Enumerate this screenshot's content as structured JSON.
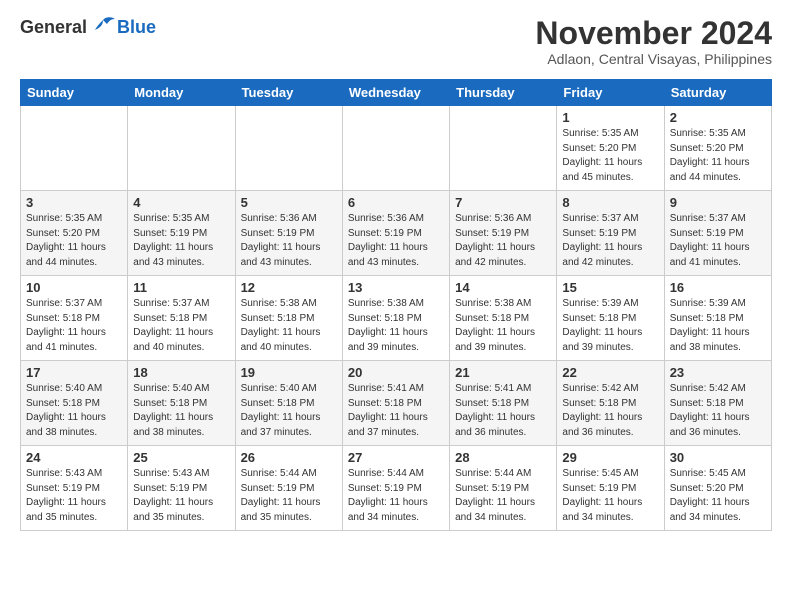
{
  "header": {
    "logo": {
      "general": "General",
      "blue": "Blue"
    },
    "month": "November 2024",
    "location": "Adlaon, Central Visayas, Philippines"
  },
  "weekdays": [
    "Sunday",
    "Monday",
    "Tuesday",
    "Wednesday",
    "Thursday",
    "Friday",
    "Saturday"
  ],
  "weeks": [
    [
      {
        "day": null
      },
      {
        "day": null
      },
      {
        "day": null
      },
      {
        "day": null
      },
      {
        "day": null
      },
      {
        "day": 1,
        "sunrise": "5:35 AM",
        "sunset": "5:20 PM",
        "daylight": "11 hours and 45 minutes."
      },
      {
        "day": 2,
        "sunrise": "5:35 AM",
        "sunset": "5:20 PM",
        "daylight": "11 hours and 44 minutes."
      }
    ],
    [
      {
        "day": 3,
        "sunrise": "5:35 AM",
        "sunset": "5:20 PM",
        "daylight": "11 hours and 44 minutes."
      },
      {
        "day": 4,
        "sunrise": "5:35 AM",
        "sunset": "5:19 PM",
        "daylight": "11 hours and 43 minutes."
      },
      {
        "day": 5,
        "sunrise": "5:36 AM",
        "sunset": "5:19 PM",
        "daylight": "11 hours and 43 minutes."
      },
      {
        "day": 6,
        "sunrise": "5:36 AM",
        "sunset": "5:19 PM",
        "daylight": "11 hours and 43 minutes."
      },
      {
        "day": 7,
        "sunrise": "5:36 AM",
        "sunset": "5:19 PM",
        "daylight": "11 hours and 42 minutes."
      },
      {
        "day": 8,
        "sunrise": "5:37 AM",
        "sunset": "5:19 PM",
        "daylight": "11 hours and 42 minutes."
      },
      {
        "day": 9,
        "sunrise": "5:37 AM",
        "sunset": "5:19 PM",
        "daylight": "11 hours and 41 minutes."
      }
    ],
    [
      {
        "day": 10,
        "sunrise": "5:37 AM",
        "sunset": "5:18 PM",
        "daylight": "11 hours and 41 minutes."
      },
      {
        "day": 11,
        "sunrise": "5:37 AM",
        "sunset": "5:18 PM",
        "daylight": "11 hours and 40 minutes."
      },
      {
        "day": 12,
        "sunrise": "5:38 AM",
        "sunset": "5:18 PM",
        "daylight": "11 hours and 40 minutes."
      },
      {
        "day": 13,
        "sunrise": "5:38 AM",
        "sunset": "5:18 PM",
        "daylight": "11 hours and 39 minutes."
      },
      {
        "day": 14,
        "sunrise": "5:38 AM",
        "sunset": "5:18 PM",
        "daylight": "11 hours and 39 minutes."
      },
      {
        "day": 15,
        "sunrise": "5:39 AM",
        "sunset": "5:18 PM",
        "daylight": "11 hours and 39 minutes."
      },
      {
        "day": 16,
        "sunrise": "5:39 AM",
        "sunset": "5:18 PM",
        "daylight": "11 hours and 38 minutes."
      }
    ],
    [
      {
        "day": 17,
        "sunrise": "5:40 AM",
        "sunset": "5:18 PM",
        "daylight": "11 hours and 38 minutes."
      },
      {
        "day": 18,
        "sunrise": "5:40 AM",
        "sunset": "5:18 PM",
        "daylight": "11 hours and 38 minutes."
      },
      {
        "day": 19,
        "sunrise": "5:40 AM",
        "sunset": "5:18 PM",
        "daylight": "11 hours and 37 minutes."
      },
      {
        "day": 20,
        "sunrise": "5:41 AM",
        "sunset": "5:18 PM",
        "daylight": "11 hours and 37 minutes."
      },
      {
        "day": 21,
        "sunrise": "5:41 AM",
        "sunset": "5:18 PM",
        "daylight": "11 hours and 36 minutes."
      },
      {
        "day": 22,
        "sunrise": "5:42 AM",
        "sunset": "5:18 PM",
        "daylight": "11 hours and 36 minutes."
      },
      {
        "day": 23,
        "sunrise": "5:42 AM",
        "sunset": "5:18 PM",
        "daylight": "11 hours and 36 minutes."
      }
    ],
    [
      {
        "day": 24,
        "sunrise": "5:43 AM",
        "sunset": "5:19 PM",
        "daylight": "11 hours and 35 minutes."
      },
      {
        "day": 25,
        "sunrise": "5:43 AM",
        "sunset": "5:19 PM",
        "daylight": "11 hours and 35 minutes."
      },
      {
        "day": 26,
        "sunrise": "5:44 AM",
        "sunset": "5:19 PM",
        "daylight": "11 hours and 35 minutes."
      },
      {
        "day": 27,
        "sunrise": "5:44 AM",
        "sunset": "5:19 PM",
        "daylight": "11 hours and 34 minutes."
      },
      {
        "day": 28,
        "sunrise": "5:44 AM",
        "sunset": "5:19 PM",
        "daylight": "11 hours and 34 minutes."
      },
      {
        "day": 29,
        "sunrise": "5:45 AM",
        "sunset": "5:19 PM",
        "daylight": "11 hours and 34 minutes."
      },
      {
        "day": 30,
        "sunrise": "5:45 AM",
        "sunset": "5:20 PM",
        "daylight": "11 hours and 34 minutes."
      }
    ]
  ]
}
